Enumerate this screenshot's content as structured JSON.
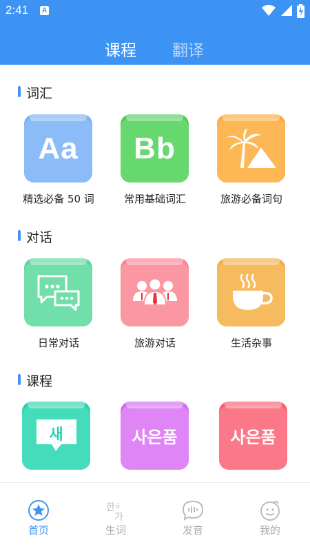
{
  "status_bar": {
    "time": "2:41",
    "notification_glyph": "A"
  },
  "header": {
    "tabs": [
      {
        "label": "课程",
        "active": true
      },
      {
        "label": "翻译",
        "active": false
      }
    ]
  },
  "sections": [
    {
      "title": "词汇",
      "items": [
        {
          "label": "精选必备 50 词",
          "glyph": "Aa",
          "icon": "letters-aa-icon",
          "color": "#86b9f7"
        },
        {
          "label": "常用基础词汇",
          "glyph": "Bb",
          "icon": "letters-bb-icon",
          "color": "#62d56a"
        },
        {
          "label": "旅游必备词句",
          "glyph": "",
          "icon": "palm-tree-icon",
          "color": "#fdb24f"
        }
      ]
    },
    {
      "title": "对话",
      "items": [
        {
          "label": "日常对话",
          "icon": "chat-bubbles-icon",
          "color": "#6edba6"
        },
        {
          "label": "旅游对话",
          "icon": "group-people-icon",
          "color": "#fb8f9c"
        },
        {
          "label": "生活杂事",
          "icon": "coffee-cup-icon",
          "color": "#f6b75a"
        }
      ]
    },
    {
      "title": "课程",
      "items": [
        {
          "label": "",
          "glyph": "새",
          "icon": "hangul-bubble-icon",
          "color": "#3fdbb8"
        },
        {
          "label": "",
          "glyph": "사은품",
          "icon": "hangul-text-icon",
          "color": "#d77af3"
        },
        {
          "label": "",
          "glyph": "사은품",
          "icon": "hangul-text-icon",
          "color": "#fb6e80"
        }
      ]
    }
  ],
  "bottom_nav": [
    {
      "label": "首页",
      "icon": "home-star-icon",
      "active": true
    },
    {
      "label": "生词",
      "icon": "hangul-word-icon",
      "active": false
    },
    {
      "label": "发音",
      "icon": "speech-bubble-icon",
      "active": false
    },
    {
      "label": "我的",
      "icon": "profile-face-icon",
      "active": false
    }
  ],
  "colors": {
    "brand": "#3d93f4",
    "inactive": "#aaaaaa"
  }
}
